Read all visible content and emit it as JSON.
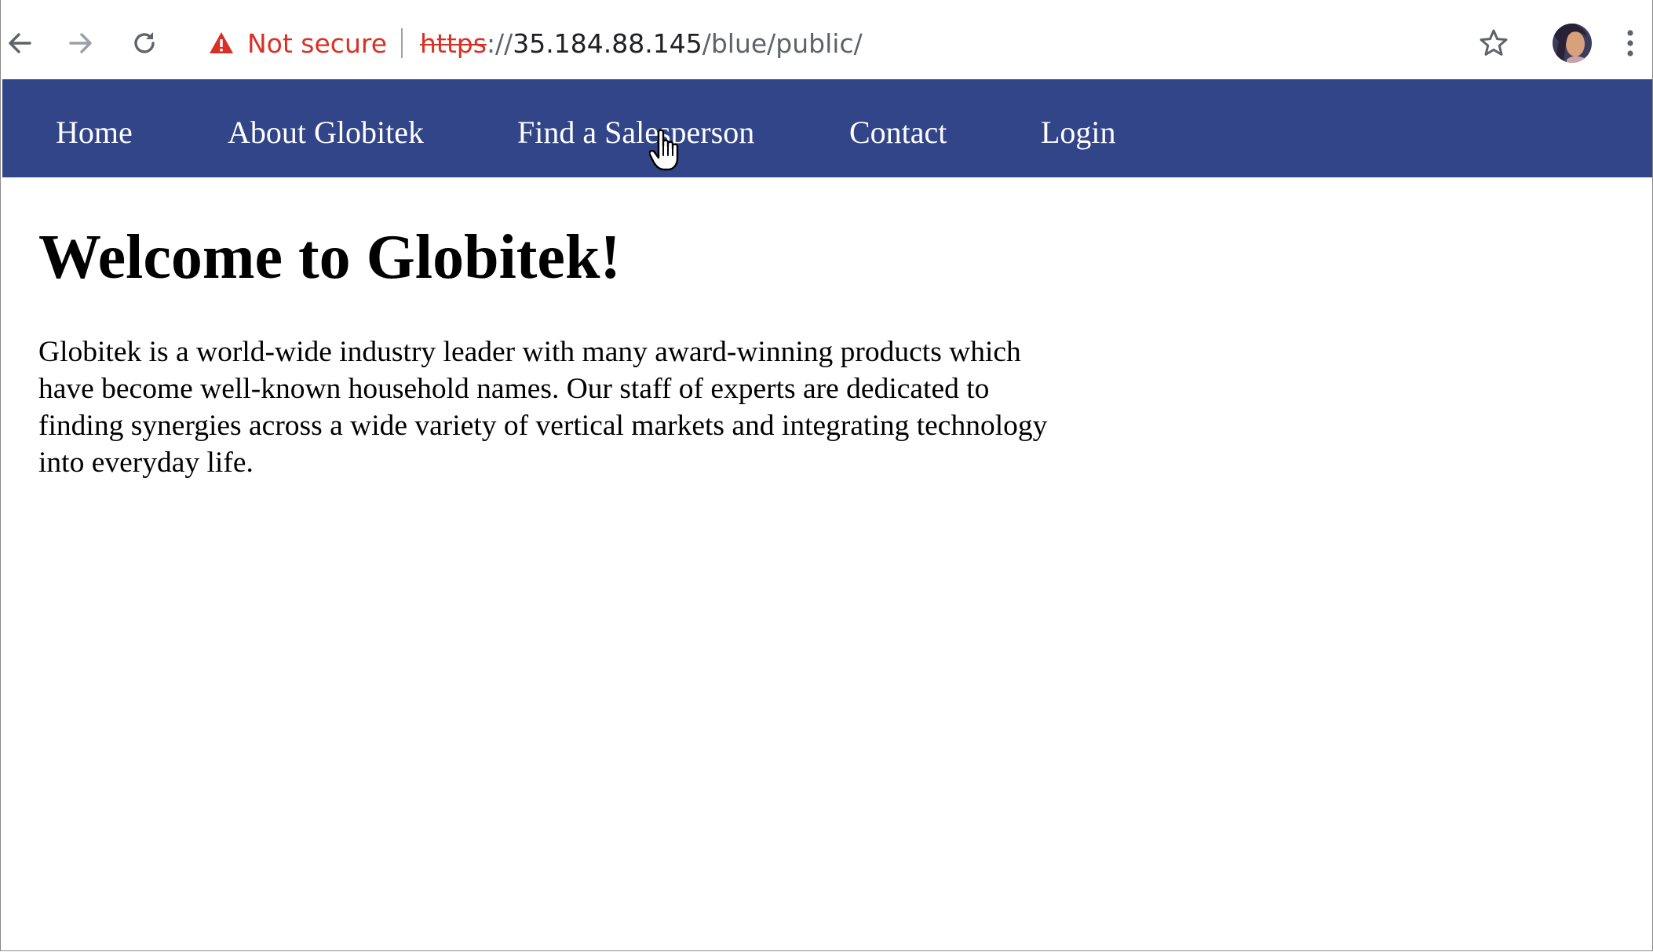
{
  "browser": {
    "security_label": "Not secure",
    "url": {
      "scheme": "https",
      "separator": "://",
      "host": "35.184.88.145",
      "path": "/blue/public/"
    },
    "icons": {
      "back": "back-arrow-icon",
      "forward": "forward-arrow-icon",
      "reload": "reload-icon",
      "warning": "warning-triangle-icon",
      "bookmark": "star-icon",
      "profile": "avatar",
      "menu": "kebab-menu-icon"
    },
    "colors": {
      "insecure_red": "#d93025"
    }
  },
  "site": {
    "nav": [
      {
        "label": "Home"
      },
      {
        "label": "About Globitek"
      },
      {
        "label": "Find a Salesperson"
      },
      {
        "label": "Contact"
      },
      {
        "label": "Login"
      }
    ],
    "heading": "Welcome to Globitek!",
    "intro_text": "Globitek is a world-wide industry leader with many award-winning products which have become well-known household names. Our staff of experts are dedicated to finding synergies across a wide variety of vertical markets and integrating technology into everyday life.",
    "colors": {
      "nav_background": "#324588",
      "nav_text": "#ffffff"
    }
  }
}
